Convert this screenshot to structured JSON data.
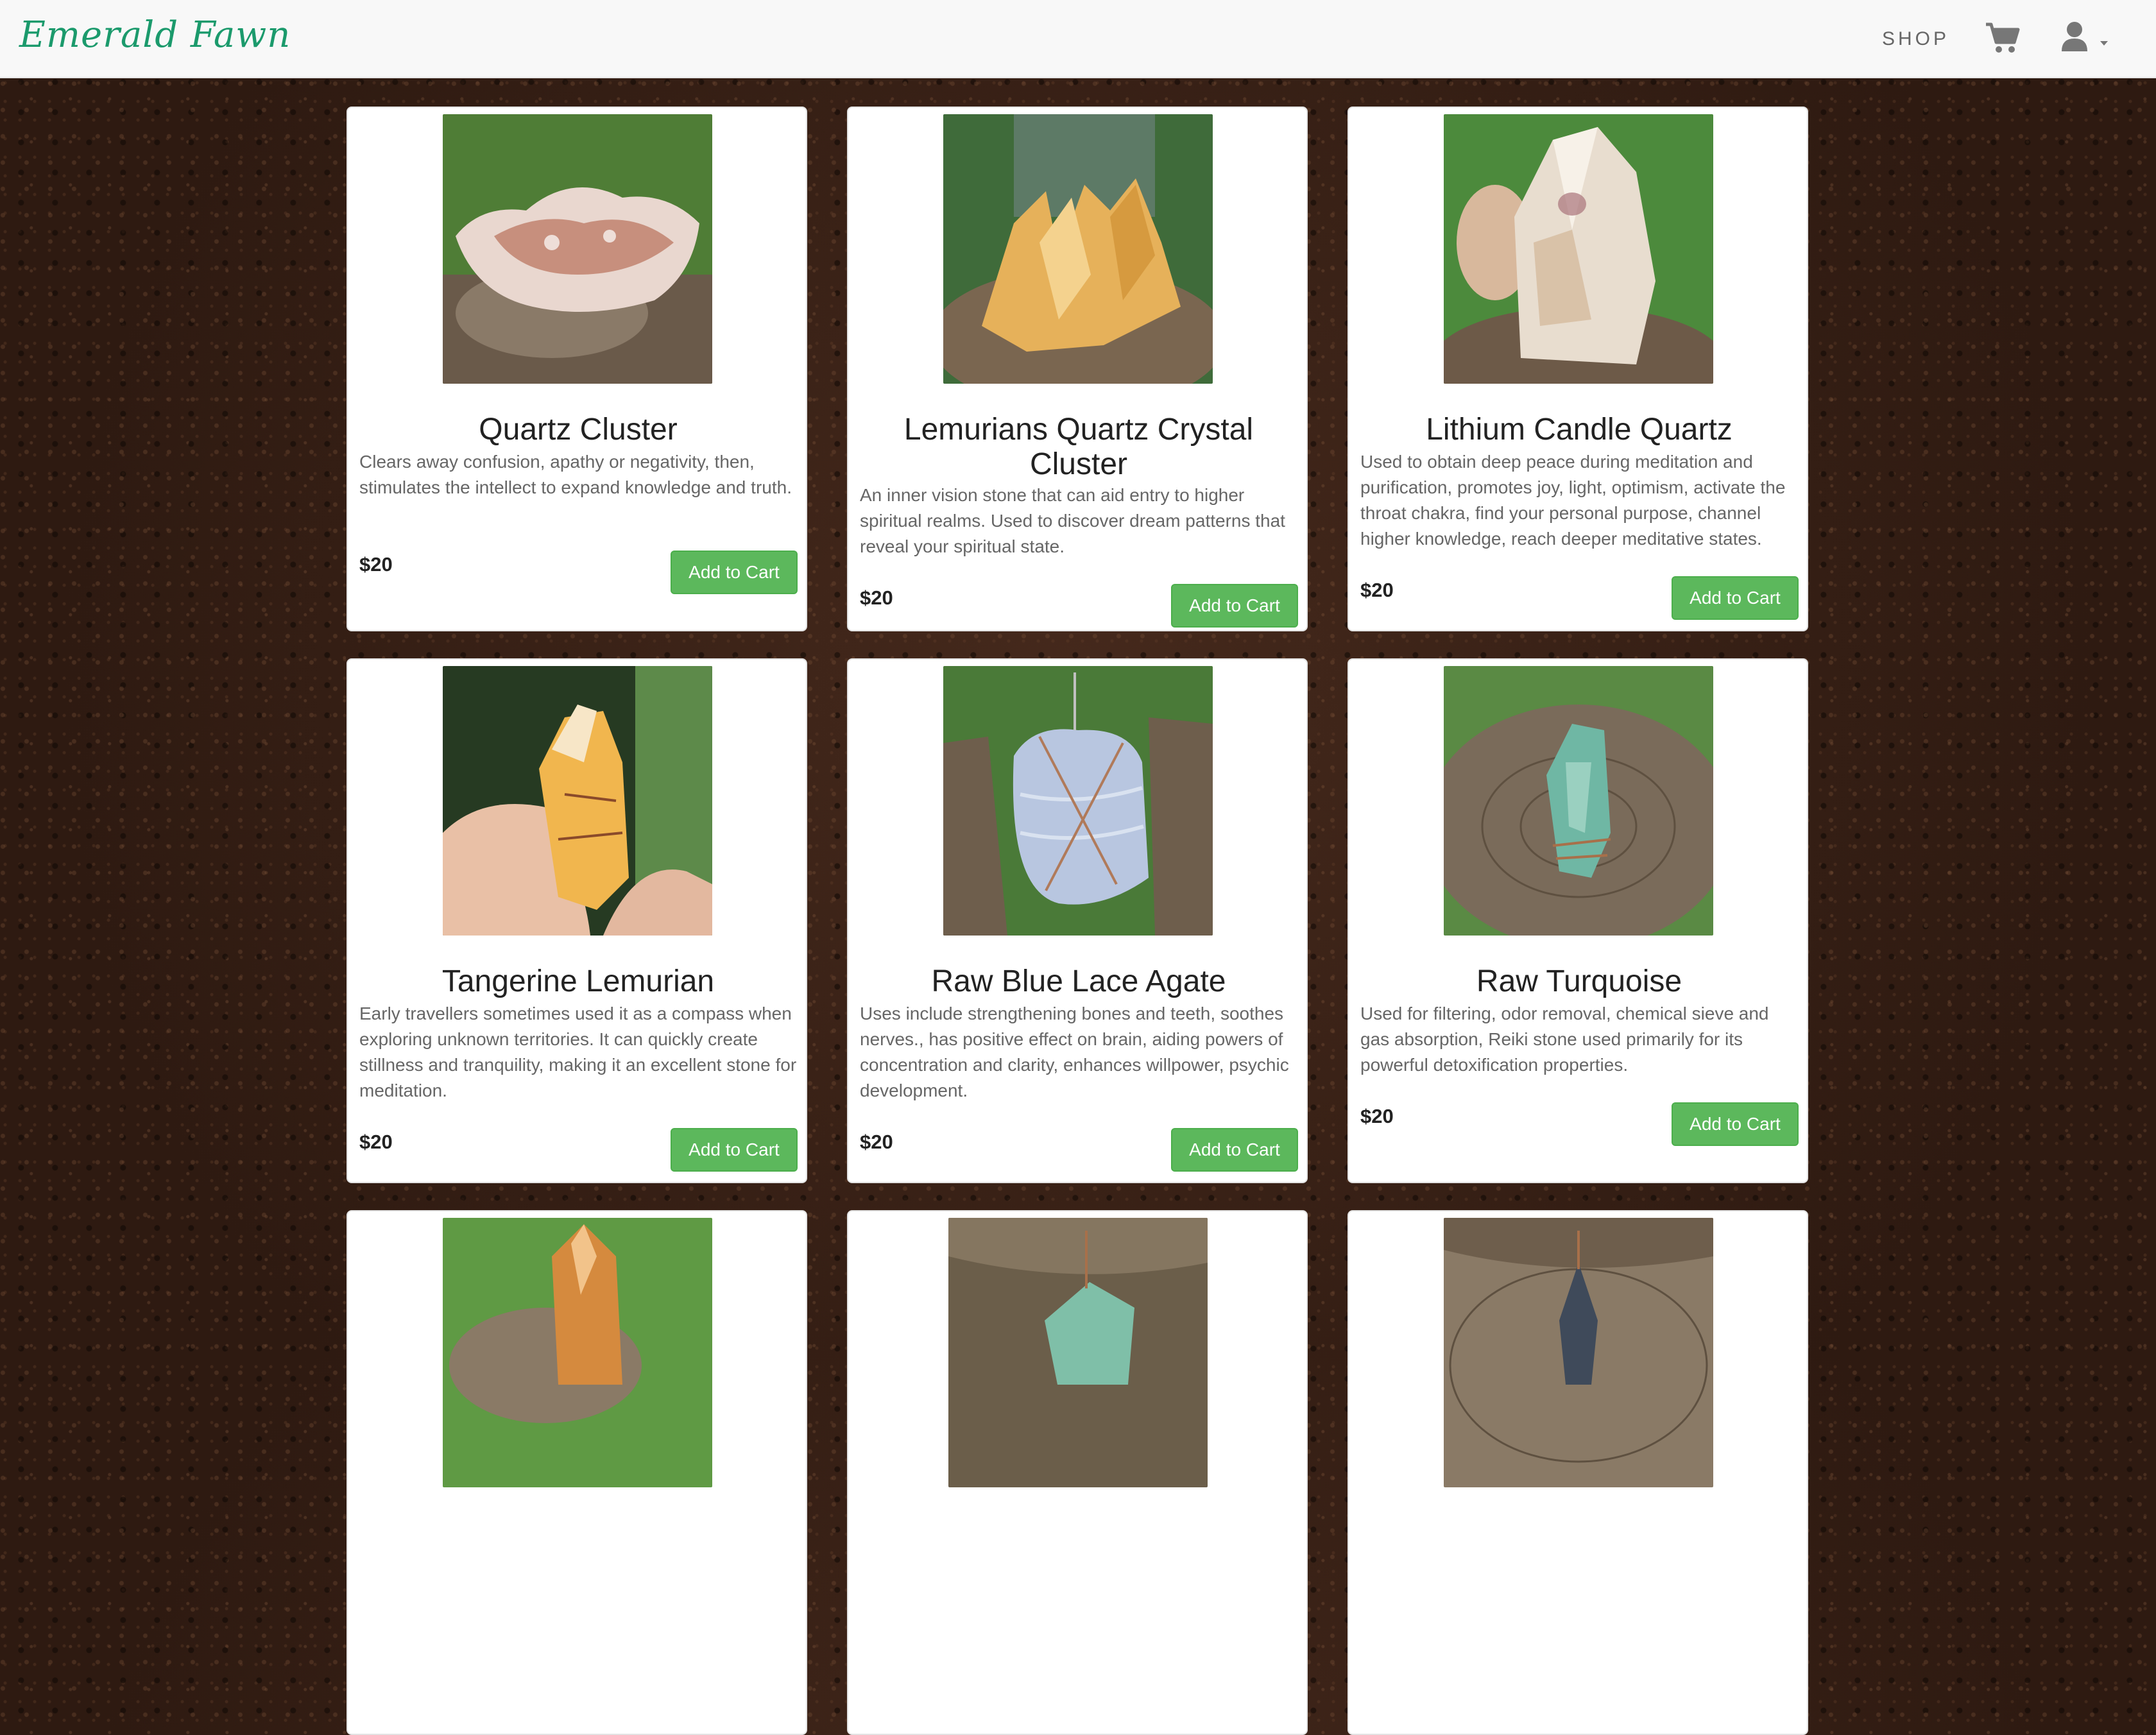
{
  "navbar": {
    "brand": "Emerald Fawn",
    "shop_label": "SHOP"
  },
  "products": [
    {
      "title": "Quartz Cluster",
      "description": "Clears away confusion, apathy or negativity, then, stimulates the intellect to expand knowledge and truth.",
      "price": "$20",
      "button": "Add to Cart"
    },
    {
      "title": "Lemurians Quartz Crystal Cluster",
      "description": "An inner vision stone that can aid entry to higher spiritual realms. Used to discover dream patterns that reveal your spiritual state.",
      "price": "$20",
      "button": "Add to Cart"
    },
    {
      "title": "Lithium Candle Quartz",
      "description": "Used to obtain deep peace during meditation and purification, promotes joy, light, optimism, activate the throat chakra, find your personal purpose, channel higher knowledge, reach deeper meditative states.",
      "price": "$20",
      "button": "Add to Cart"
    },
    {
      "title": "Tangerine Lemurian",
      "description": "Early travellers sometimes used it as a compass when exploring unknown territories. It can quickly create stillness and tranquility, making it an excellent stone for meditation.",
      "price": "$20",
      "button": "Add to Cart"
    },
    {
      "title": "Raw Blue Lace Agate",
      "description": "Uses include strengthening bones and teeth, soothes nerves., has positive effect on brain, aiding powers of concentration and clarity, enhances willpower, psychic development.",
      "price": "$20",
      "button": "Add to Cart"
    },
    {
      "title": "Raw Turquoise",
      "description": "Used for filtering, odor removal, chemical sieve and gas absorption, Reiki stone used primarily for its powerful detoxification properties.",
      "price": "$20",
      "button": "Add to Cart"
    }
  ],
  "colors": {
    "brand": "#1b9a6c",
    "button": "#5cb85c",
    "navbar_bg": "#f8f8f8"
  }
}
